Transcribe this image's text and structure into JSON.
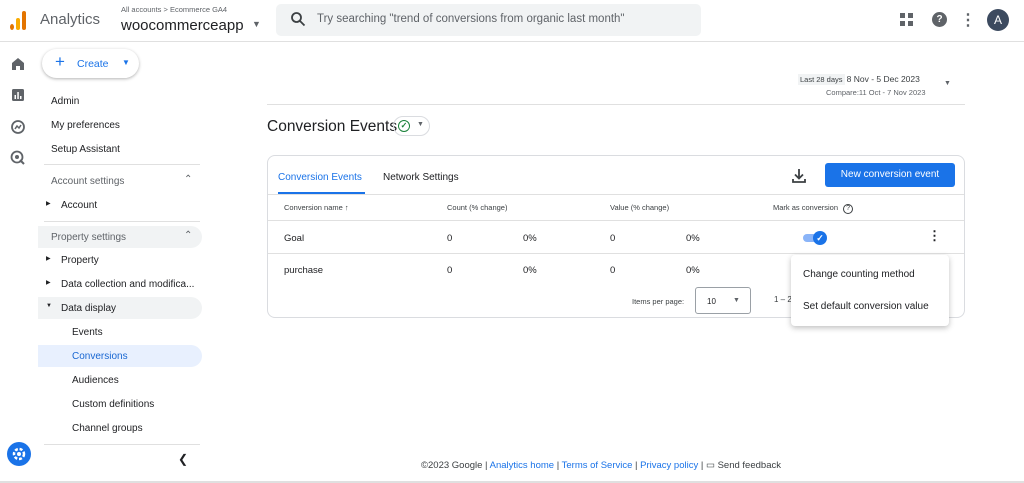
{
  "header": {
    "app_name": "Analytics",
    "account_path": "All accounts > Ecommerce GA4",
    "account_name": "woocommerceapp",
    "search_placeholder": "Try searching \"trend of conversions from organic last month\"",
    "avatar_initial": "A"
  },
  "nav": {
    "create_label": "Create",
    "top_items": [
      "Admin",
      "My preferences",
      "Setup Assistant"
    ],
    "account_settings": {
      "label": "Account settings",
      "items": [
        "Account"
      ]
    },
    "property_settings": {
      "label": "Property settings",
      "items": [
        "Property",
        "Data collection and modifica...",
        "Data display"
      ]
    },
    "data_display_items": [
      "Events",
      "Conversions",
      "Audiences",
      "Custom definitions",
      "Channel groups"
    ],
    "active_item": "Conversions"
  },
  "date_range": {
    "label": "Last 28 days",
    "main": "8 Nov - 5 Dec 2023",
    "compare": "Compare:11 Oct - 7 Nov 2023"
  },
  "page": {
    "title": "Conversion Events",
    "tabs": [
      "Conversion Events",
      "Network Settings"
    ],
    "new_button": "New conversion event",
    "columns": {
      "name": "Conversion name",
      "count": "Count (% change)",
      "value": "Value (% change)",
      "mark": "Mark as conversion"
    },
    "rows": [
      {
        "name": "Goal",
        "count": "0",
        "count_change": "0%",
        "value": "0",
        "value_change": "0%",
        "marked": true
      },
      {
        "name": "purchase",
        "count": "0",
        "count_change": "0%",
        "value": "0",
        "value_change": "0%"
      }
    ],
    "items_per_page_label": "Items per page:",
    "items_per_page": "10",
    "range_text": "1 – 2"
  },
  "context_menu": {
    "items": [
      "Change counting method",
      "Set default conversion value"
    ]
  },
  "footer": {
    "copyright": "©2023 Google |",
    "analytics_home": "Analytics home",
    "sep1": "|",
    "terms": "Terms of Service",
    "sep2": "|",
    "privacy": "Privacy policy",
    "sep3": "|",
    "feedback": "Send feedback"
  },
  "colors": {
    "accent": "#1a73e8",
    "success": "#188038",
    "active_bg": "#e8f0fe"
  }
}
